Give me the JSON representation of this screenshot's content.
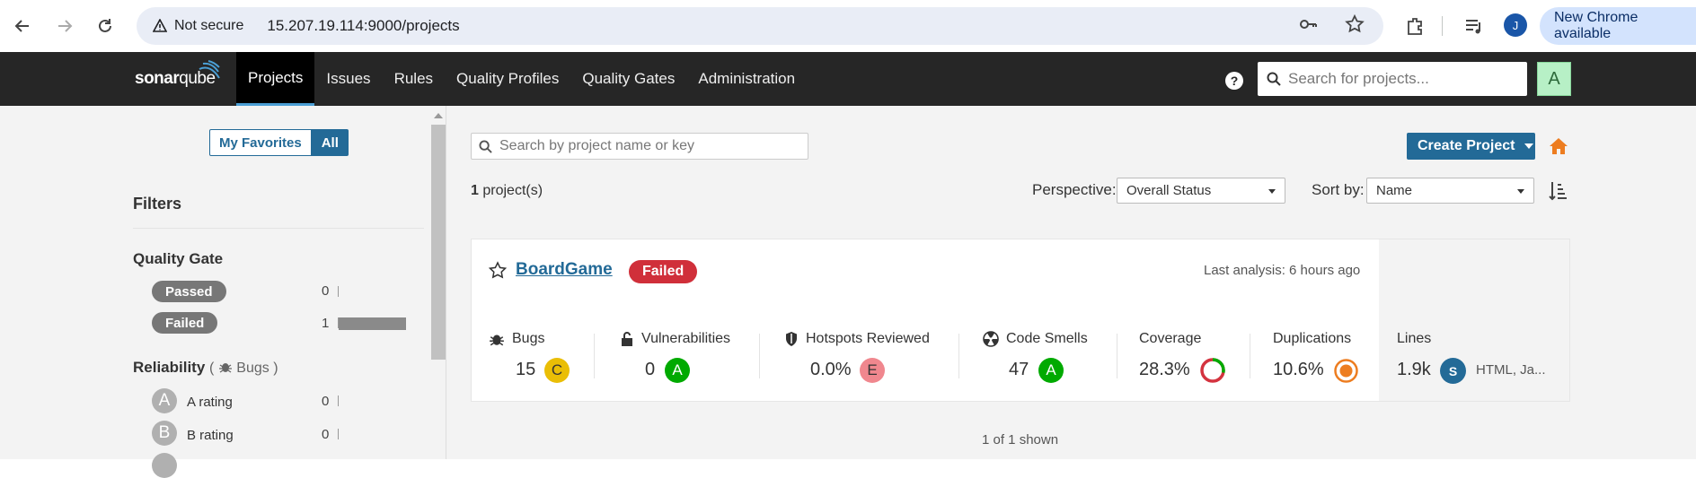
{
  "browser": {
    "security_label": "Not secure",
    "url": "15.207.19.114:9000/projects",
    "profile_initial": "J",
    "update_label": "New Chrome available"
  },
  "nav": {
    "logo_bold": "sonar",
    "logo_thin": "qube",
    "items": [
      "Projects",
      "Issues",
      "Rules",
      "Quality Profiles",
      "Quality Gates",
      "Administration"
    ],
    "active_index": 0,
    "help_label": "?",
    "search_placeholder": "Search for projects...",
    "user_initial": "A"
  },
  "sidebar": {
    "favorites_label": "My Favorites",
    "all_label": "All",
    "filters_title": "Filters",
    "quality_gate": {
      "title": "Quality Gate",
      "items": [
        {
          "label": "Passed",
          "count": "0",
          "fraction": 0
        },
        {
          "label": "Failed",
          "count": "1",
          "fraction": 1
        }
      ]
    },
    "reliability": {
      "title": "Reliability",
      "open_paren": "(",
      "sub": "Bugs",
      "close_paren": ")",
      "items": [
        {
          "grade": "A",
          "label": "A rating",
          "count": "0"
        },
        {
          "grade": "B",
          "label": "B rating",
          "count": "0"
        }
      ]
    }
  },
  "main": {
    "search_placeholder": "Search by project name or key",
    "create_label": "Create Project",
    "project_count": "1",
    "project_count_suffix": "project(s)",
    "perspective_label": "Perspective:",
    "perspective_value": "Overall Status",
    "sort_label": "Sort by:",
    "sort_value": "Name",
    "shown_label": "1 of 1 shown"
  },
  "project": {
    "name": "BoardGame",
    "status": "Failed",
    "last_analysis": "Last analysis: 6 hours ago",
    "metrics": {
      "bugs": {
        "label": "Bugs",
        "value": "15",
        "grade": "C",
        "grade_color": "#eabe06"
      },
      "vulnerabilities": {
        "label": "Vulnerabilities",
        "value": "0",
        "grade": "A",
        "grade_color": "#0a0"
      },
      "hotspots": {
        "label": "Hotspots Reviewed",
        "value": "0.0%",
        "grade": "E",
        "grade_color": "#d4333f"
      },
      "code_smells": {
        "label": "Code Smells",
        "value": "47",
        "grade": "A",
        "grade_color": "#0a0"
      },
      "coverage": {
        "label": "Coverage",
        "value": "28.3%",
        "fraction": 0.283
      },
      "duplications": {
        "label": "Duplications",
        "value": "10.6%"
      },
      "lines": {
        "label": "Lines",
        "value": "1.9k",
        "lang_badge": "S",
        "languages": "HTML, Ja..."
      }
    }
  },
  "colors": {
    "nav_bg": "#262626",
    "accent": "#236a97",
    "failed": "#d02f3a",
    "orange": "#ed7d20"
  }
}
